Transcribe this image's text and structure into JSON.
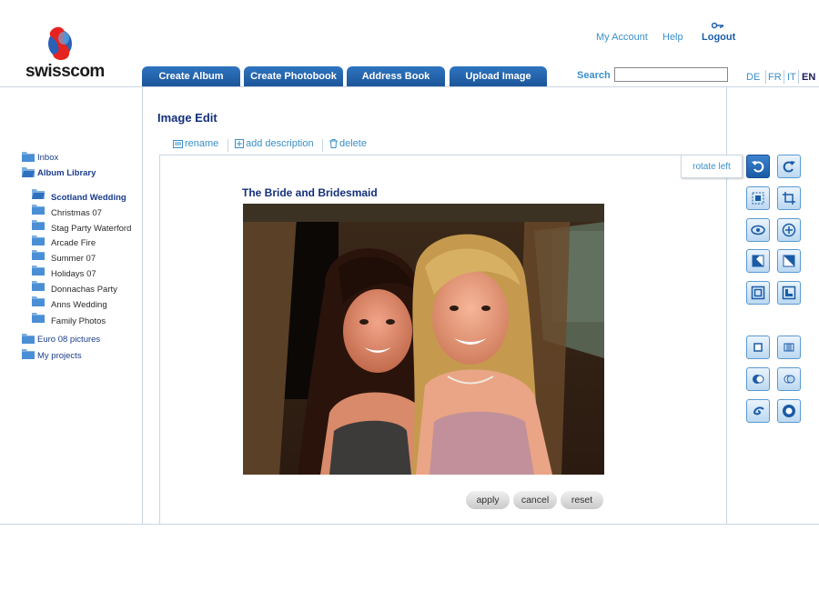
{
  "header": {
    "logo_text": "swisscom",
    "links": {
      "account": "My Account",
      "help": "Help",
      "logout": "Logout"
    },
    "tabs": [
      "Create Album",
      "Create Photobook",
      "Address Book",
      "Upload Image"
    ],
    "search": {
      "label": "Search",
      "value": ""
    },
    "languages": [
      "DE",
      "FR",
      "IT",
      "EN"
    ],
    "active_language": "EN"
  },
  "sidebar": {
    "top_items": [
      "Inbox",
      "Album Library"
    ],
    "albums": [
      "Scotland Wedding",
      "Christmas 07",
      "Stag Party Waterford",
      "Arcade Fire",
      "Summer 07",
      "Holidays 07",
      "Donnachas Party",
      "Anns Wedding",
      "Family Photos"
    ],
    "bottom_items": [
      "Euro 08 pictures",
      "My projects"
    ],
    "selected_album": "Scotland Wedding"
  },
  "main": {
    "title": "Image Edit",
    "actions": {
      "rename": "rename",
      "add_description": "add description",
      "delete": "delete"
    },
    "image_title": "The Bride and Bridesmaid",
    "buttons": {
      "apply": "apply",
      "cancel": "cancel",
      "reset": "reset"
    }
  },
  "tools": {
    "tooltip": "rotate left",
    "items": [
      "rotate-left-icon",
      "rotate-right-icon",
      "crop-icon",
      "resize-icon",
      "red-eye-icon",
      "zoom-icon",
      "brightness-icon",
      "contrast-icon",
      "frame-icon",
      "shadow-icon",
      "border-icon",
      "film-icon",
      "sepia-icon",
      "blur-icon",
      "swirl-icon",
      "vignette-icon"
    ],
    "active": "rotate-left-icon"
  },
  "colors": {
    "tab_blue": "#1b5599",
    "link_blue": "#3a8fc8",
    "title_navy": "#13307a"
  }
}
